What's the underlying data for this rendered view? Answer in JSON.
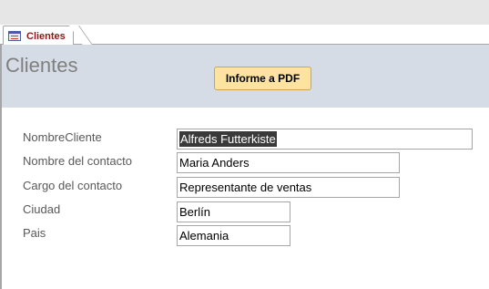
{
  "tab": {
    "label": "Clientes",
    "icon": "form-icon"
  },
  "header": {
    "title": "Clientes",
    "pdf_button_label": "Informe a PDF"
  },
  "fields": [
    {
      "label": "NombreCliente",
      "value": "Alfreds Futterkiste",
      "selected": true
    },
    {
      "label": "Nombre del contacto",
      "value": "Maria Anders",
      "selected": false
    },
    {
      "label": "Cargo del contacto",
      "value": "Representante de ventas",
      "selected": false
    },
    {
      "label": "Ciudad",
      "value": "Berlín",
      "selected": false
    },
    {
      "label": "Pais",
      "value": "Alemania",
      "selected": false
    }
  ],
  "colors": {
    "header_background": "#d6dce6",
    "button_background": "#fce4a0",
    "tab_label": "#8b1a1a",
    "selection": "#3a3a3a"
  }
}
